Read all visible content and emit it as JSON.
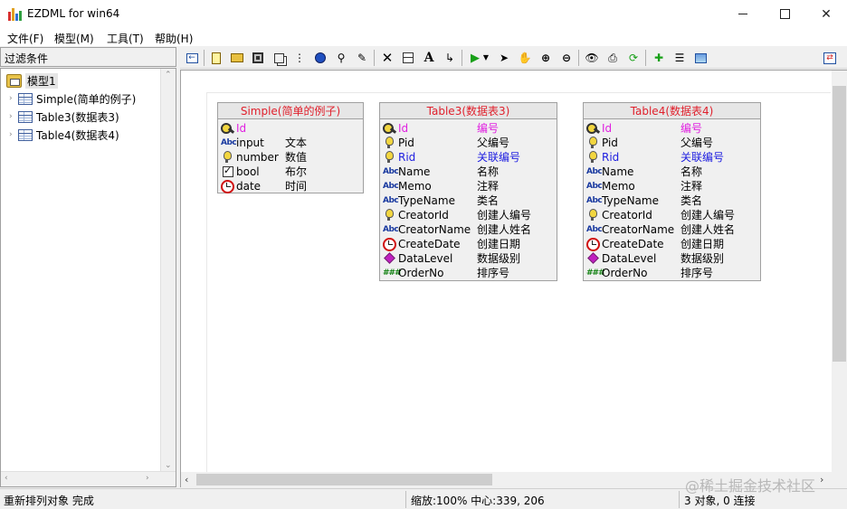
{
  "window": {
    "title": "EZDML for win64",
    "min": "—",
    "max": "☐",
    "close": "✕"
  },
  "menu": [
    "文件(F)",
    "模型(M)",
    "工具(T)",
    "帮助(H)"
  ],
  "left": {
    "filter_label": "过滤条件",
    "model": "模型1",
    "tables": [
      "Simple(简单的例子)",
      "Table3(数据表3)",
      "Table4(数据表4)"
    ]
  },
  "entities": [
    {
      "title": "Simple(简单的例子)",
      "fields": [
        {
          "icon": "key-icon",
          "name": "Id",
          "comment": "",
          "style": "pk"
        },
        {
          "icon": "text-type-icon",
          "name": "input",
          "comment": "文本",
          "style": ""
        },
        {
          "icon": "bulb-icon",
          "name": "number",
          "comment": "数值",
          "style": ""
        },
        {
          "icon": "checkbox-icon",
          "name": "bool",
          "comment": "布尔",
          "style": ""
        },
        {
          "icon": "clock-icon",
          "name": "date",
          "comment": "时间",
          "style": ""
        }
      ]
    },
    {
      "title": "Table3(数据表3)",
      "fields": [
        {
          "icon": "key-icon",
          "name": "Id",
          "comment": "编号",
          "style": "pk"
        },
        {
          "icon": "bulb-icon",
          "name": "Pid",
          "comment": "父编号",
          "style": ""
        },
        {
          "icon": "bulb-icon",
          "name": "Rid",
          "comment": "关联编号",
          "style": "fk"
        },
        {
          "icon": "text-type-icon",
          "name": "Name",
          "comment": "名称",
          "style": ""
        },
        {
          "icon": "text-type-icon",
          "name": "Memo",
          "comment": "注释",
          "style": ""
        },
        {
          "icon": "text-type-icon",
          "name": "TypeName",
          "comment": "类名",
          "style": ""
        },
        {
          "icon": "bulb-icon",
          "name": "CreatorId",
          "comment": "创建人编号",
          "style": ""
        },
        {
          "icon": "text-type-icon",
          "name": "CreatorName",
          "comment": "创建人姓名",
          "style": ""
        },
        {
          "icon": "clock-icon",
          "name": "CreateDate",
          "comment": "创建日期",
          "style": ""
        },
        {
          "icon": "diamond-icon",
          "name": "DataLevel",
          "comment": "数据级别",
          "style": ""
        },
        {
          "icon": "hash-icon",
          "name": "OrderNo",
          "comment": "排序号",
          "style": ""
        }
      ]
    },
    {
      "title": "Table4(数据表4)",
      "fields": [
        {
          "icon": "key-icon",
          "name": "Id",
          "comment": "编号",
          "style": "pk"
        },
        {
          "icon": "bulb-icon",
          "name": "Pid",
          "comment": "父编号",
          "style": ""
        },
        {
          "icon": "bulb-icon",
          "name": "Rid",
          "comment": "关联编号",
          "style": "fk"
        },
        {
          "icon": "text-type-icon",
          "name": "Name",
          "comment": "名称",
          "style": ""
        },
        {
          "icon": "text-type-icon",
          "name": "Memo",
          "comment": "注释",
          "style": ""
        },
        {
          "icon": "text-type-icon",
          "name": "TypeName",
          "comment": "类名",
          "style": ""
        },
        {
          "icon": "bulb-icon",
          "name": "CreatorId",
          "comment": "创建人编号",
          "style": ""
        },
        {
          "icon": "text-type-icon",
          "name": "CreatorName",
          "comment": "创建人姓名",
          "style": ""
        },
        {
          "icon": "clock-icon",
          "name": "CreateDate",
          "comment": "创建日期",
          "style": ""
        },
        {
          "icon": "diamond-icon",
          "name": "DataLevel",
          "comment": "数据级别",
          "style": ""
        },
        {
          "icon": "hash-icon",
          "name": "OrderNo",
          "comment": "排序号",
          "style": ""
        }
      ]
    }
  ],
  "toolbar_icons": [
    "back-icon",
    "new-icon",
    "open-icon",
    "save-icon",
    "copy-icon",
    "tree-icon",
    "globe-icon",
    "find-icon",
    "pencil-icon",
    "delete-icon",
    "table-icon",
    "text-icon",
    "link-icon",
    "run-icon",
    "run-dropdown-icon",
    "pointer-icon",
    "hand-icon",
    "zoom-in-icon",
    "zoom-out-icon",
    "view-icon",
    "print-icon",
    "refresh-icon",
    "add-icon",
    "properties-icon",
    "image-icon",
    "dock-icon"
  ],
  "status": {
    "message": "重新排列对象 完成",
    "zoom": "缩放:100% 中心:339, 206",
    "count": "3 对象, 0 连接"
  },
  "watermark": "@稀土掘金技术社区"
}
